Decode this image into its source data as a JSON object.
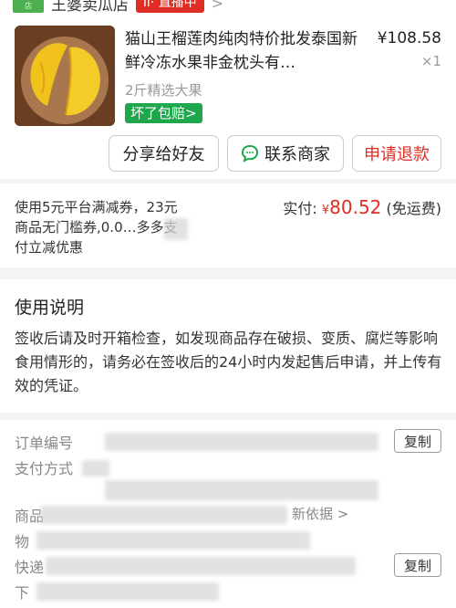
{
  "shop": {
    "logo_text": "王婆卖瓜店",
    "name": "王婆卖瓜店",
    "live_label": "直播中"
  },
  "product": {
    "title": "猫山王榴莲肉纯肉特价批发泰国新鲜冷冻水果非金枕头有…",
    "price": "¥108.58",
    "quantity": "×1",
    "spec": "2斤精选大果",
    "guarantee": "坏了包赔>"
  },
  "actions": {
    "share": "分享给好友",
    "contact": "联系商家",
    "refund": "申请退款"
  },
  "summary": {
    "discount_text": "使用5元平台满减券，23元商品无门槛券,0.0…多多支付立减优惠",
    "paid_label": "实付:",
    "currency": "¥",
    "amount": "80.52",
    "shipping": "(免运费)"
  },
  "instructions": {
    "heading": "使用说明",
    "body": "签收后请及时开箱检查，如发现商品存在破损、变质、腐烂等影响食用情形的，请务必在签收后的24小时内发起售后申请，并上传有效的凭证。"
  },
  "order": {
    "order_no_label": "订单编号",
    "pay_method_label": "支付方式",
    "product_label": "商品",
    "proof_label": "新依据 >",
    "logistics_label": "物",
    "express_label": "快递",
    "next_label": "下",
    "copy_label": "复制"
  },
  "colors": {
    "accent": "#e02e24",
    "guarantee": "#1fa84b"
  }
}
